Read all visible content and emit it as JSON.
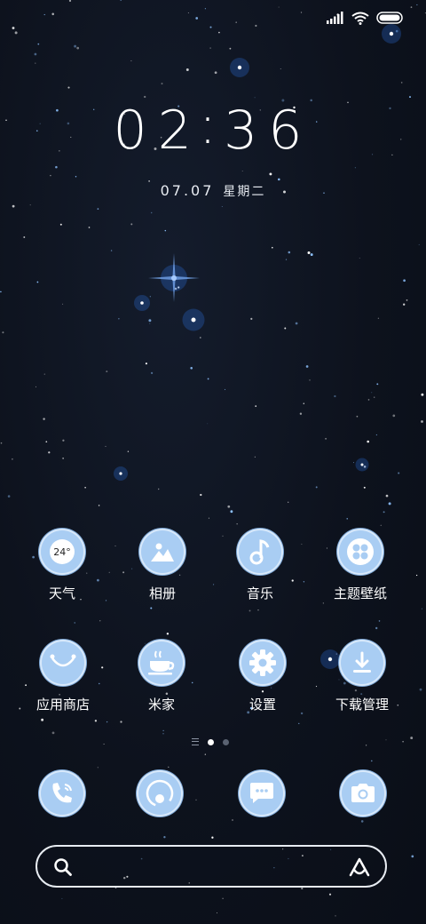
{
  "status_bar": {
    "icons": [
      "signal-icon",
      "wifi-icon",
      "battery-icon"
    ]
  },
  "lockclock": {
    "hour": "02",
    "separator": ":",
    "minute": "36",
    "date": "07.07",
    "weekday": "星期二"
  },
  "apps_row1": [
    {
      "label": "天气",
      "icon": "weather-icon",
      "badge": "24°"
    },
    {
      "label": "相册",
      "icon": "gallery-icon"
    },
    {
      "label": "音乐",
      "icon": "music-icon"
    },
    {
      "label": "主题壁纸",
      "icon": "themes-icon"
    }
  ],
  "apps_row2": [
    {
      "label": "应用商店",
      "icon": "app-store-icon"
    },
    {
      "label": "米家",
      "icon": "mi-home-icon"
    },
    {
      "label": "设置",
      "icon": "settings-icon"
    },
    {
      "label": "下载管理",
      "icon": "downloads-icon"
    }
  ],
  "pager": {
    "pages": 2,
    "active": 0
  },
  "dock": [
    {
      "icon": "phone-icon"
    },
    {
      "icon": "browser-icon"
    },
    {
      "icon": "messages-icon"
    },
    {
      "icon": "camera-icon"
    }
  ],
  "search_bar": {
    "left_icon": "search-icon",
    "right_icon": "assistant-icon"
  },
  "colors": {
    "icon_bg": "#a9cdf3",
    "icon_ring": "#d7e8fa",
    "background": "#0d121d"
  }
}
